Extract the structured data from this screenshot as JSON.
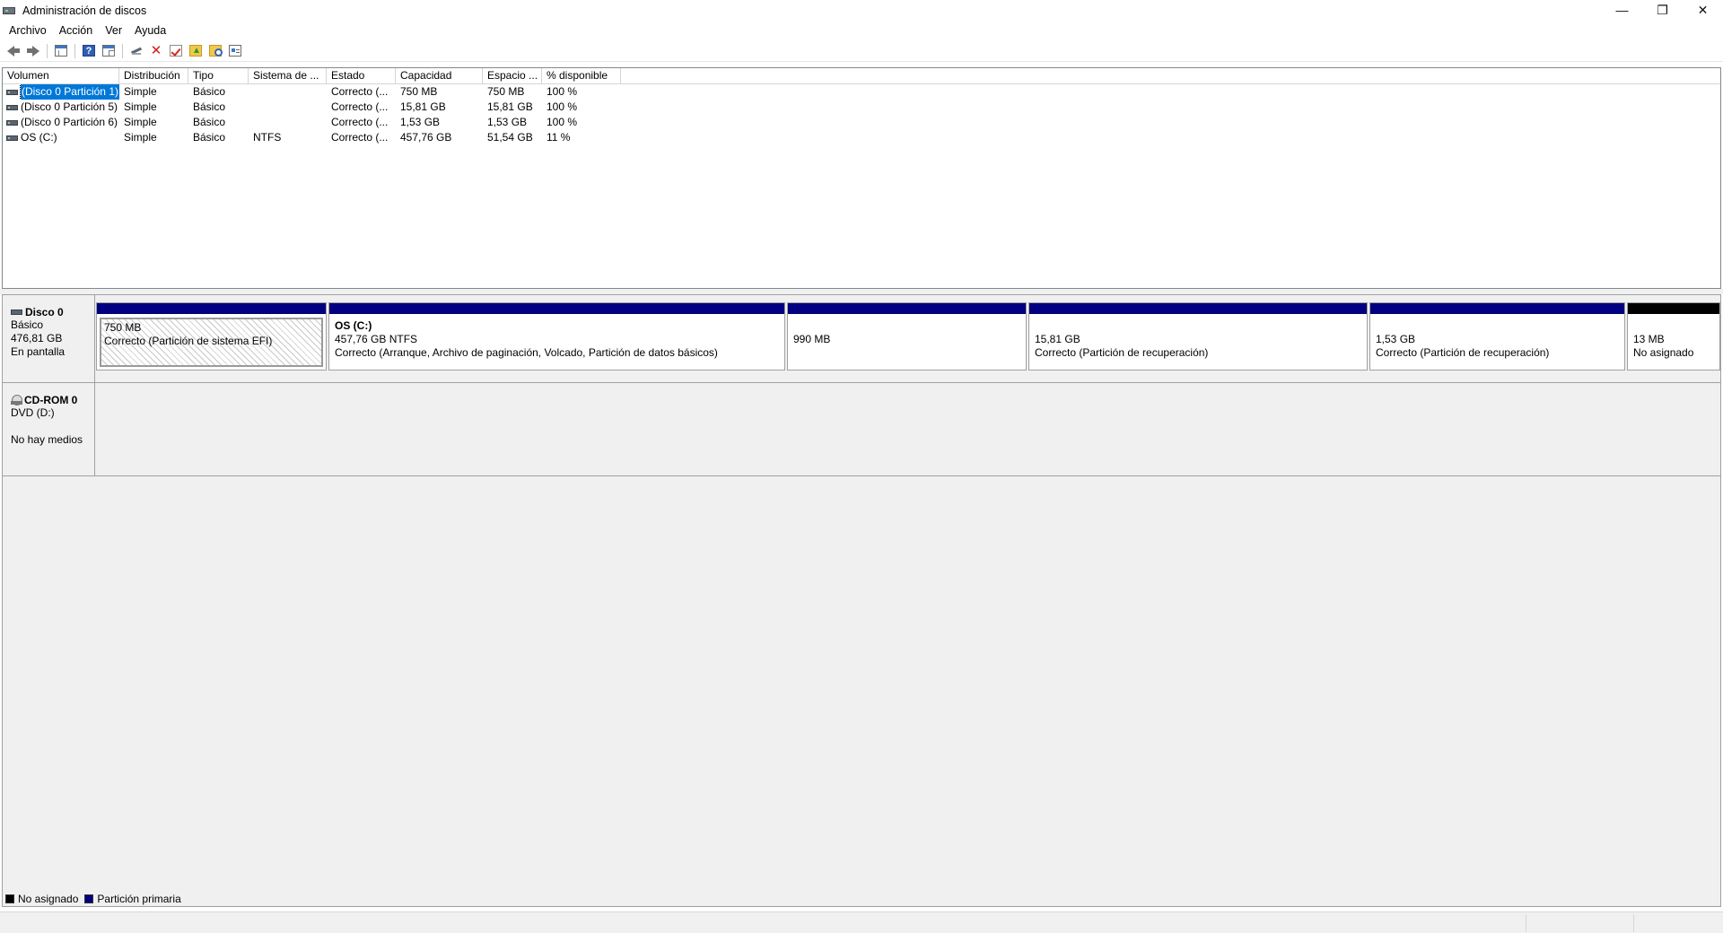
{
  "window": {
    "title": "Administración de discos",
    "controls": {
      "minimize": "—",
      "restore": "❐",
      "close": "✕"
    }
  },
  "menu": [
    "Archivo",
    "Acción",
    "Ver",
    "Ayuda"
  ],
  "toolbar": {
    "icons": [
      "arrow-left-icon",
      "arrow-right-icon",
      "window-icon",
      "help-icon",
      "properties-icon",
      "connect-icon",
      "delete-icon",
      "check-icon",
      "folder-up-icon",
      "folder-search-icon",
      "list-icon"
    ],
    "help_glyph": "?",
    "delete_glyph": "✕"
  },
  "volume_list": {
    "columns": [
      "Volumen",
      "Distribución",
      "Tipo",
      "Sistema de ...",
      "Estado",
      "Capacidad",
      "Espacio ...",
      "% disponible"
    ],
    "rows": [
      {
        "volume": "(Disco 0 Partición 1)",
        "layout": "Simple",
        "type": "Básico",
        "fs": "",
        "status": "Correcto (...",
        "capacity": "750 MB",
        "free": "750 MB",
        "pct": "100 %",
        "selected": true
      },
      {
        "volume": "(Disco 0 Partición 5)",
        "layout": "Simple",
        "type": "Básico",
        "fs": "",
        "status": "Correcto (...",
        "capacity": "15,81 GB",
        "free": "15,81 GB",
        "pct": "100 %"
      },
      {
        "volume": "(Disco 0 Partición 6)",
        "layout": "Simple",
        "type": "Básico",
        "fs": "",
        "status": "Correcto (...",
        "capacity": "1,53 GB",
        "free": "1,53 GB",
        "pct": "100 %"
      },
      {
        "volume": "OS (C:)",
        "layout": "Simple",
        "type": "Básico",
        "fs": "NTFS",
        "status": "Correcto (...",
        "capacity": "457,76 GB",
        "free": "51,54 GB",
        "pct": "11 %"
      }
    ]
  },
  "disks": {
    "disk0": {
      "name": "Disco 0",
      "type": "Básico",
      "size": "476,81 GB",
      "state": "En pantalla",
      "partitions": [
        {
          "name": "",
          "size": "750 MB",
          "status": "Correcto (Partición de sistema EFI)",
          "kind": "primary",
          "hatched": true
        },
        {
          "name": "OS  (C:)",
          "size": "457,76 GB NTFS",
          "status": "Correcto (Arranque, Archivo de paginación, Volcado, Partición de datos básicos)",
          "kind": "primary"
        },
        {
          "name": "",
          "size": "990 MB",
          "status": "",
          "kind": "primary"
        },
        {
          "name": "",
          "size": "15,81 GB",
          "status": "Correcto (Partición de recuperación)",
          "kind": "primary"
        },
        {
          "name": "",
          "size": "1,53 GB",
          "status": "Correcto (Partición de recuperación)",
          "kind": "primary"
        },
        {
          "name": "",
          "size": "13 MB",
          "status": "No asignado",
          "kind": "unallocated"
        }
      ]
    },
    "cdrom0": {
      "name": "CD-ROM 0",
      "drive": "DVD (D:)",
      "media": "No hay medios"
    }
  },
  "legend": [
    {
      "label": "No asignado",
      "color": "#000000"
    },
    {
      "label": "Partición primaria",
      "color": "#000080"
    }
  ],
  "colors": {
    "primary": "#000080",
    "unallocated": "#000000",
    "selection": "#0078d7"
  }
}
